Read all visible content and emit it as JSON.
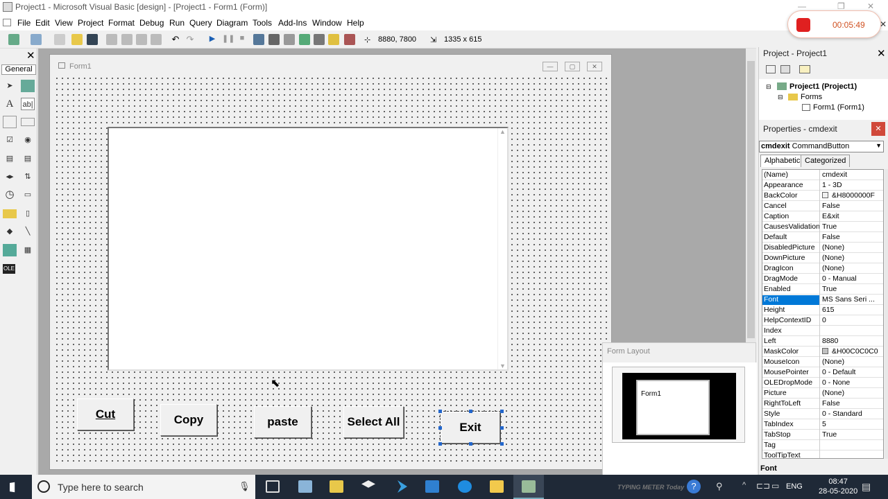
{
  "window": {
    "title": "Project1 - Microsoft Visual Basic [design] - [Project1 - Form1 (Form)]"
  },
  "menus": [
    "File",
    "Edit",
    "View",
    "Project",
    "Format",
    "Debug",
    "Run",
    "Query",
    "Diagram",
    "Tools",
    "Add-Ins",
    "Window",
    "Help"
  ],
  "toolbar": {
    "position": "8880, 7800",
    "size": "1335 x 615"
  },
  "recorder": {
    "time": "00:05:49"
  },
  "toolbox": {
    "tab": "General",
    "close": "✕"
  },
  "form": {
    "caption": "Form1",
    "buttons": {
      "cut": "Cut",
      "copy": "Copy",
      "paste": "paste",
      "select_all": "Select All",
      "exit": "Exit"
    }
  },
  "project": {
    "title": "Project - Project1",
    "root": "Project1 (Project1)",
    "folder": "Forms",
    "item": "Form1 (Form1)"
  },
  "properties": {
    "title": "Properties - cmdexit",
    "object_name": "cmdexit",
    "object_type": "CommandButton",
    "tabs": [
      "Alphabetic",
      "Categorized"
    ],
    "footer": "Font",
    "rows": [
      {
        "n": "(Name)",
        "v": "cmdexit"
      },
      {
        "n": "Appearance",
        "v": "1 - 3D"
      },
      {
        "n": "BackColor",
        "v": "&H8000000F",
        "swatch": "#f0f0f0"
      },
      {
        "n": "Cancel",
        "v": "False"
      },
      {
        "n": "Caption",
        "v": "E&xit"
      },
      {
        "n": "CausesValidation",
        "v": "True"
      },
      {
        "n": "Default",
        "v": "False"
      },
      {
        "n": "DisabledPicture",
        "v": "(None)"
      },
      {
        "n": "DownPicture",
        "v": "(None)"
      },
      {
        "n": "DragIcon",
        "v": "(None)"
      },
      {
        "n": "DragMode",
        "v": "0 - Manual"
      },
      {
        "n": "Enabled",
        "v": "True"
      },
      {
        "n": "Font",
        "v": "MS Sans Seri ...",
        "selected": true
      },
      {
        "n": "Height",
        "v": "615"
      },
      {
        "n": "HelpContextID",
        "v": "0"
      },
      {
        "n": "Index",
        "v": ""
      },
      {
        "n": "Left",
        "v": "8880"
      },
      {
        "n": "MaskColor",
        "v": "&H00C0C0C0",
        "swatch": "#c0c0c0"
      },
      {
        "n": "MouseIcon",
        "v": "(None)"
      },
      {
        "n": "MousePointer",
        "v": "0 - Default"
      },
      {
        "n": "OLEDropMode",
        "v": "0 - None"
      },
      {
        "n": "Picture",
        "v": "(None)"
      },
      {
        "n": "RightToLeft",
        "v": "False"
      },
      {
        "n": "Style",
        "v": "0 - Standard"
      },
      {
        "n": "TabIndex",
        "v": "5"
      },
      {
        "n": "TabStop",
        "v": "True"
      },
      {
        "n": "Tag",
        "v": ""
      },
      {
        "n": "ToolTipText",
        "v": ""
      }
    ]
  },
  "form_layout": {
    "title": "Form Layout",
    "form": "Form1"
  },
  "taskbar": {
    "search_placeholder": "Type here to search",
    "lang": "ENG",
    "time": "08:47",
    "date": "28-05-2020",
    "ad": "TYPING METER Today"
  },
  "colors": {
    "selection": "#0078d7",
    "taskbar": "#1f2937",
    "record": "#e02020",
    "handles": "#2266cc"
  }
}
